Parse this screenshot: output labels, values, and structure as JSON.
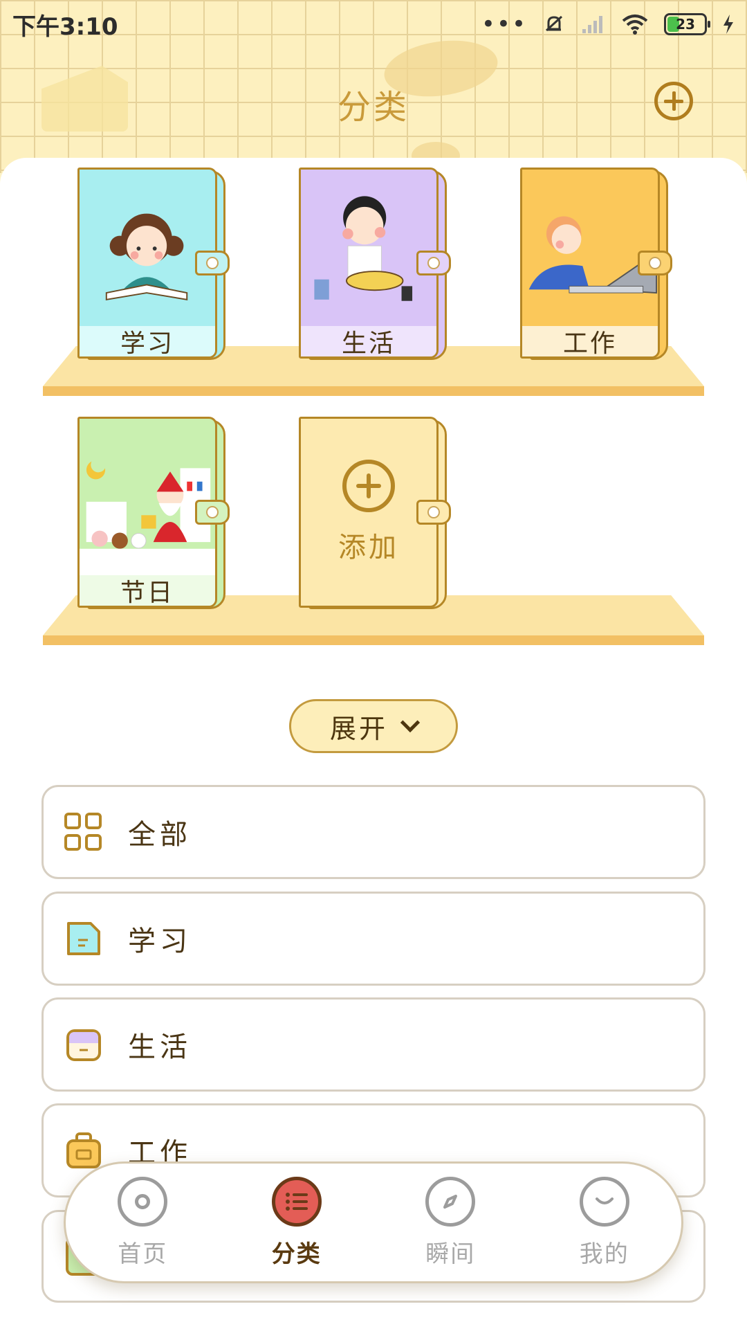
{
  "status_bar": {
    "time": "下午3:10",
    "battery": "23",
    "dots": "•••"
  },
  "header": {
    "title": "分类",
    "add_icon": "plus-circle-icon"
  },
  "shelf": {
    "books": [
      {
        "label": "学习",
        "color": "#a8eef0",
        "clasp_color": "#bff2f2"
      },
      {
        "label": "生活",
        "color": "#d9c4f7",
        "clasp_color": "#e3d2fa"
      },
      {
        "label": "工作",
        "color": "#fbc85a",
        "clasp_color": "#fbd272"
      },
      {
        "label": "节日",
        "color": "#c9f0b0",
        "clasp_color": "#d4f3bf"
      }
    ],
    "add_book_label": "添加"
  },
  "expand_button": {
    "label": "展开",
    "icon": "chevron-down-icon"
  },
  "categories": [
    {
      "label": "全部",
      "icon": "grid-icon"
    },
    {
      "label": "学习",
      "icon": "note-icon"
    },
    {
      "label": "生活",
      "icon": "box-icon"
    },
    {
      "label": "工作",
      "icon": "bag-icon"
    }
  ],
  "bottom_nav": [
    {
      "label": "首页",
      "icon": "disc-icon",
      "active": false
    },
    {
      "label": "分类",
      "icon": "list-icon",
      "active": true
    },
    {
      "label": "瞬间",
      "icon": "compass-icon",
      "active": false
    },
    {
      "label": "我的",
      "icon": "smile-icon",
      "active": false
    }
  ]
}
